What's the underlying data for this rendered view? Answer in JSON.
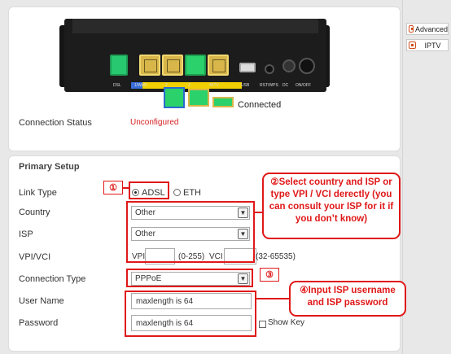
{
  "sidebar": {
    "advanced_label": "Advanced",
    "iptv_label": "IPTV"
  },
  "status": {
    "connected_text": "Connected",
    "connection_status_label": "Connection Status",
    "connection_status_value": "Unconfigured"
  },
  "router_labels": [
    "DSL",
    "1/WAN",
    "2",
    "3",
    "4/ITV",
    "USB",
    "RST/WPS",
    "DC",
    "ON/OFF"
  ],
  "setup": {
    "title": "Primary Setup",
    "link_type_label": "Link Type",
    "link_options": [
      "ADSL",
      "ETH"
    ],
    "link_selected": "ADSL",
    "country_label": "Country",
    "country_value": "Other",
    "isp_label": "ISP",
    "isp_value": "Other",
    "vpivci_label": "VPI/VCI",
    "vpi_label": "VPI",
    "vpi_range": "(0-255)",
    "vci_label": "VCI",
    "vci_range": "(32-65535)",
    "connection_type_label": "Connection Type",
    "connection_type_value": "PPPoE",
    "username_label": "User Name",
    "username_placeholder": "maxlength is 64",
    "password_label": "Password",
    "password_placeholder": "maxlength is 64",
    "show_key_label": "Show Key"
  },
  "annotations": {
    "step1": "①",
    "step2_text": "②Select country and ISP or type VPI / VCI derectly (you can consult your ISP for it if you don’t know)",
    "step3": "③",
    "step4_text": "④Input ISP username and ISP password"
  }
}
